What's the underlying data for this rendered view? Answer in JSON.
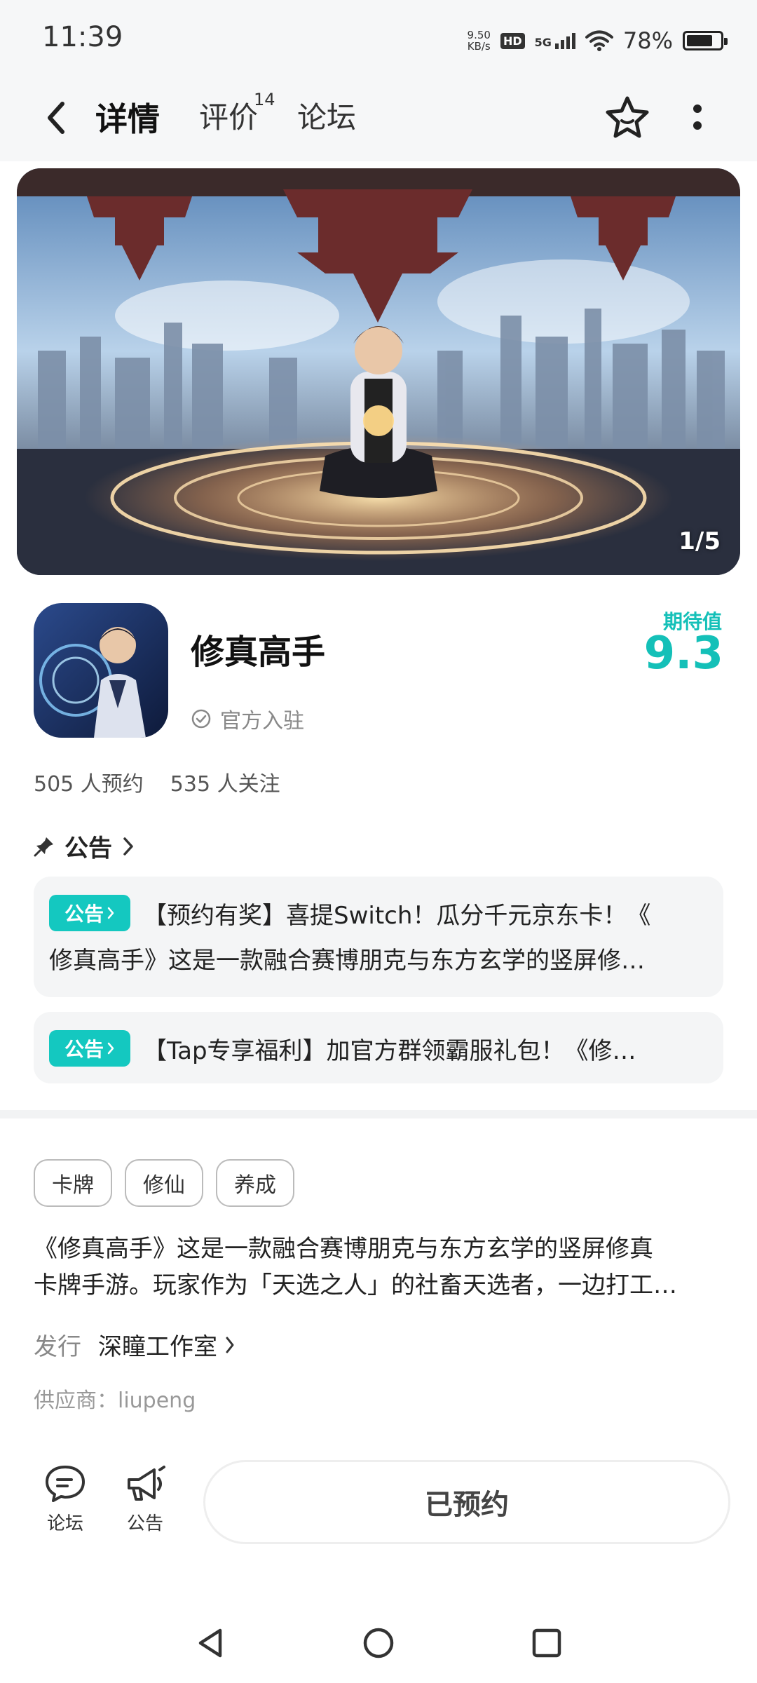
{
  "status_bar": {
    "time": "11:39",
    "net_speed_value": "9.50",
    "net_speed_unit": "KB/s",
    "hd_label": "HD",
    "network_label": "5G",
    "battery_percent": "78%",
    "battery_level": 0.78
  },
  "nav": {
    "tabs": [
      {
        "label": "详情",
        "active": true
      },
      {
        "label": "评价",
        "badge": "14"
      },
      {
        "label": "论坛"
      }
    ]
  },
  "banner": {
    "counter": "1/5"
  },
  "app": {
    "title": "修真高手",
    "verified_label": "官方入驻",
    "score_label": "期待值",
    "score_value": "9.3",
    "reservations": "505 人预约",
    "followers": "535 人关注"
  },
  "announcements": {
    "header": "公告",
    "badge_label": "公告",
    "items": [
      {
        "line1": "【预约有奖】喜提Switch！瓜分千元京东卡！《",
        "line2": "修真高手》这是一款融合赛博朋克与东方玄学的竖屏修…"
      },
      {
        "line1": "【Tap专享福利】加官方群领霸服礼包！《修…"
      }
    ]
  },
  "tags": [
    "卡牌",
    "修仙",
    "养成"
  ],
  "description": {
    "line1": "《修真高手》这是一款融合赛博朋克与东方玄学的竖屏修真",
    "line2": "卡牌手游。玩家作为「天选之人」的社畜天选者，一边打工…"
  },
  "publisher": {
    "label": "发行",
    "name": "深瞳工作室"
  },
  "supplier": "供应商：liupeng",
  "bottom_bar": {
    "forum_label": "论坛",
    "announce_label": "公告",
    "reserve_label": "已预约"
  },
  "colors": {
    "accent": "#14c8c0",
    "background": "#f6f7f8"
  }
}
